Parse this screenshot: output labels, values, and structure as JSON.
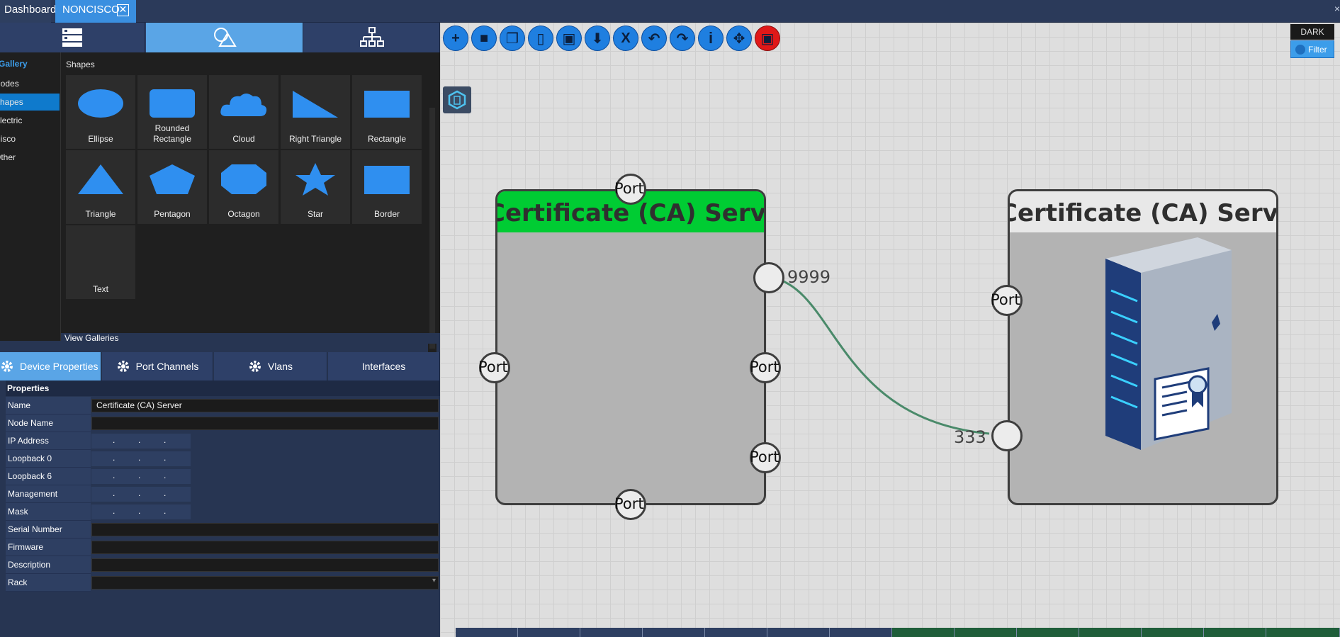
{
  "tabs": {
    "dashboard": "Dashboard",
    "noncisco": "NONCISCO",
    "close_glyph": "✕",
    "window_close": "×"
  },
  "icon_tabs": [
    {
      "name": "server-icon"
    },
    {
      "name": "shapes-icon"
    },
    {
      "name": "hierarchy-icon"
    }
  ],
  "gallery": {
    "title": "Gallery",
    "items": [
      "Nodes",
      "Shapes",
      "Electric",
      "Cisco",
      "Other"
    ],
    "active_index": 1,
    "shapes_label": "Shapes",
    "shapes": [
      {
        "label": "Ellipse",
        "icon": "ellipse-icon"
      },
      {
        "label": "Rounded\nRectangle",
        "icon": "rounded-rectangle-icon"
      },
      {
        "label": "Cloud",
        "icon": "cloud-icon"
      },
      {
        "label": "Right Triangle",
        "icon": "right-triangle-icon"
      },
      {
        "label": "Rectangle",
        "icon": "rectangle-icon"
      },
      {
        "label": "Triangle",
        "icon": "triangle-icon"
      },
      {
        "label": "Pentagon",
        "icon": "pentagon-icon"
      },
      {
        "label": "Octagon",
        "icon": "octagon-icon"
      },
      {
        "label": "Star",
        "icon": "star-icon"
      },
      {
        "label": "Border",
        "icon": "border-icon"
      },
      {
        "label": "Text",
        "icon": "text-icon"
      }
    ],
    "view_galleries": "View Galleries"
  },
  "property_tabs": [
    "Device Properties",
    "Port Channels",
    "Vlans",
    "Interfaces"
  ],
  "properties": {
    "header": "Properties",
    "rows": [
      {
        "label": "Name",
        "type": "text",
        "value": "Certificate (CA) Server"
      },
      {
        "label": "Node Name",
        "type": "text",
        "value": ""
      },
      {
        "label": "IP Address",
        "type": "ip",
        "value": ""
      },
      {
        "label": "Loopback 0",
        "type": "ip",
        "value": ""
      },
      {
        "label": "Loopback 6",
        "type": "ip",
        "value": ""
      },
      {
        "label": "Management",
        "type": "ip",
        "value": ""
      },
      {
        "label": "Mask",
        "type": "ip",
        "value": ""
      },
      {
        "label": "Serial Number",
        "type": "text",
        "value": ""
      },
      {
        "label": "Firmware",
        "type": "text",
        "value": ""
      },
      {
        "label": "Description",
        "type": "text",
        "value": ""
      },
      {
        "label": "Rack",
        "type": "select",
        "value": ""
      }
    ]
  },
  "toolbar": {
    "buttons": [
      "add-icon",
      "square-icon",
      "copy-icon",
      "new-document-icon",
      "save-icon",
      "download-icon",
      "excel-icon",
      "undo-icon",
      "redo-icon",
      "info-icon",
      "move-icon",
      "delete-icon"
    ],
    "dark_label": "DARK",
    "filter_label": "Filter"
  },
  "canvas": {
    "node_left": {
      "title": "Certificate (CA) Server",
      "title_color": "#00cc33"
    },
    "node_right": {
      "title": "Certificate (CA) Server"
    },
    "port_label": "Port",
    "link_label_a": "9999",
    "link_label_b": "333",
    "link_color": "#4a8a6a"
  },
  "colors": {
    "accent": "#3c9dea",
    "toolbar_blue": "#1f7fe0",
    "toolbar_red": "#e01818"
  }
}
